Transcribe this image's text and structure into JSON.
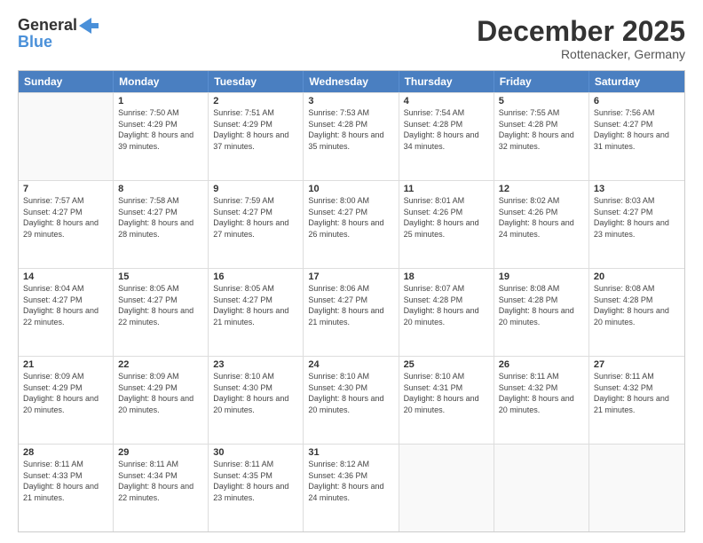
{
  "logo": {
    "general": "General",
    "blue": "Blue"
  },
  "title": {
    "month_year": "December 2025",
    "location": "Rottenacker, Germany"
  },
  "header_days": [
    "Sunday",
    "Monday",
    "Tuesday",
    "Wednesday",
    "Thursday",
    "Friday",
    "Saturday"
  ],
  "weeks": [
    [
      {
        "day": "",
        "sunrise": "",
        "sunset": "",
        "daylight": "",
        "empty": true
      },
      {
        "day": "1",
        "sunrise": "Sunrise: 7:50 AM",
        "sunset": "Sunset: 4:29 PM",
        "daylight": "Daylight: 8 hours and 39 minutes."
      },
      {
        "day": "2",
        "sunrise": "Sunrise: 7:51 AM",
        "sunset": "Sunset: 4:29 PM",
        "daylight": "Daylight: 8 hours and 37 minutes."
      },
      {
        "day": "3",
        "sunrise": "Sunrise: 7:53 AM",
        "sunset": "Sunset: 4:28 PM",
        "daylight": "Daylight: 8 hours and 35 minutes."
      },
      {
        "day": "4",
        "sunrise": "Sunrise: 7:54 AM",
        "sunset": "Sunset: 4:28 PM",
        "daylight": "Daylight: 8 hours and 34 minutes."
      },
      {
        "day": "5",
        "sunrise": "Sunrise: 7:55 AM",
        "sunset": "Sunset: 4:28 PM",
        "daylight": "Daylight: 8 hours and 32 minutes."
      },
      {
        "day": "6",
        "sunrise": "Sunrise: 7:56 AM",
        "sunset": "Sunset: 4:27 PM",
        "daylight": "Daylight: 8 hours and 31 minutes."
      }
    ],
    [
      {
        "day": "7",
        "sunrise": "Sunrise: 7:57 AM",
        "sunset": "Sunset: 4:27 PM",
        "daylight": "Daylight: 8 hours and 29 minutes."
      },
      {
        "day": "8",
        "sunrise": "Sunrise: 7:58 AM",
        "sunset": "Sunset: 4:27 PM",
        "daylight": "Daylight: 8 hours and 28 minutes."
      },
      {
        "day": "9",
        "sunrise": "Sunrise: 7:59 AM",
        "sunset": "Sunset: 4:27 PM",
        "daylight": "Daylight: 8 hours and 27 minutes."
      },
      {
        "day": "10",
        "sunrise": "Sunrise: 8:00 AM",
        "sunset": "Sunset: 4:27 PM",
        "daylight": "Daylight: 8 hours and 26 minutes."
      },
      {
        "day": "11",
        "sunrise": "Sunrise: 8:01 AM",
        "sunset": "Sunset: 4:26 PM",
        "daylight": "Daylight: 8 hours and 25 minutes."
      },
      {
        "day": "12",
        "sunrise": "Sunrise: 8:02 AM",
        "sunset": "Sunset: 4:26 PM",
        "daylight": "Daylight: 8 hours and 24 minutes."
      },
      {
        "day": "13",
        "sunrise": "Sunrise: 8:03 AM",
        "sunset": "Sunset: 4:27 PM",
        "daylight": "Daylight: 8 hours and 23 minutes."
      }
    ],
    [
      {
        "day": "14",
        "sunrise": "Sunrise: 8:04 AM",
        "sunset": "Sunset: 4:27 PM",
        "daylight": "Daylight: 8 hours and 22 minutes."
      },
      {
        "day": "15",
        "sunrise": "Sunrise: 8:05 AM",
        "sunset": "Sunset: 4:27 PM",
        "daylight": "Daylight: 8 hours and 22 minutes."
      },
      {
        "day": "16",
        "sunrise": "Sunrise: 8:05 AM",
        "sunset": "Sunset: 4:27 PM",
        "daylight": "Daylight: 8 hours and 21 minutes."
      },
      {
        "day": "17",
        "sunrise": "Sunrise: 8:06 AM",
        "sunset": "Sunset: 4:27 PM",
        "daylight": "Daylight: 8 hours and 21 minutes."
      },
      {
        "day": "18",
        "sunrise": "Sunrise: 8:07 AM",
        "sunset": "Sunset: 4:28 PM",
        "daylight": "Daylight: 8 hours and 20 minutes."
      },
      {
        "day": "19",
        "sunrise": "Sunrise: 8:08 AM",
        "sunset": "Sunset: 4:28 PM",
        "daylight": "Daylight: 8 hours and 20 minutes."
      },
      {
        "day": "20",
        "sunrise": "Sunrise: 8:08 AM",
        "sunset": "Sunset: 4:28 PM",
        "daylight": "Daylight: 8 hours and 20 minutes."
      }
    ],
    [
      {
        "day": "21",
        "sunrise": "Sunrise: 8:09 AM",
        "sunset": "Sunset: 4:29 PM",
        "daylight": "Daylight: 8 hours and 20 minutes."
      },
      {
        "day": "22",
        "sunrise": "Sunrise: 8:09 AM",
        "sunset": "Sunset: 4:29 PM",
        "daylight": "Daylight: 8 hours and 20 minutes."
      },
      {
        "day": "23",
        "sunrise": "Sunrise: 8:10 AM",
        "sunset": "Sunset: 4:30 PM",
        "daylight": "Daylight: 8 hours and 20 minutes."
      },
      {
        "day": "24",
        "sunrise": "Sunrise: 8:10 AM",
        "sunset": "Sunset: 4:30 PM",
        "daylight": "Daylight: 8 hours and 20 minutes."
      },
      {
        "day": "25",
        "sunrise": "Sunrise: 8:10 AM",
        "sunset": "Sunset: 4:31 PM",
        "daylight": "Daylight: 8 hours and 20 minutes."
      },
      {
        "day": "26",
        "sunrise": "Sunrise: 8:11 AM",
        "sunset": "Sunset: 4:32 PM",
        "daylight": "Daylight: 8 hours and 20 minutes."
      },
      {
        "day": "27",
        "sunrise": "Sunrise: 8:11 AM",
        "sunset": "Sunset: 4:32 PM",
        "daylight": "Daylight: 8 hours and 21 minutes."
      }
    ],
    [
      {
        "day": "28",
        "sunrise": "Sunrise: 8:11 AM",
        "sunset": "Sunset: 4:33 PM",
        "daylight": "Daylight: 8 hours and 21 minutes."
      },
      {
        "day": "29",
        "sunrise": "Sunrise: 8:11 AM",
        "sunset": "Sunset: 4:34 PM",
        "daylight": "Daylight: 8 hours and 22 minutes."
      },
      {
        "day": "30",
        "sunrise": "Sunrise: 8:11 AM",
        "sunset": "Sunset: 4:35 PM",
        "daylight": "Daylight: 8 hours and 23 minutes."
      },
      {
        "day": "31",
        "sunrise": "Sunrise: 8:12 AM",
        "sunset": "Sunset: 4:36 PM",
        "daylight": "Daylight: 8 hours and 24 minutes."
      },
      {
        "day": "",
        "sunrise": "",
        "sunset": "",
        "daylight": "",
        "empty": true
      },
      {
        "day": "",
        "sunrise": "",
        "sunset": "",
        "daylight": "",
        "empty": true
      },
      {
        "day": "",
        "sunrise": "",
        "sunset": "",
        "daylight": "",
        "empty": true
      }
    ]
  ]
}
